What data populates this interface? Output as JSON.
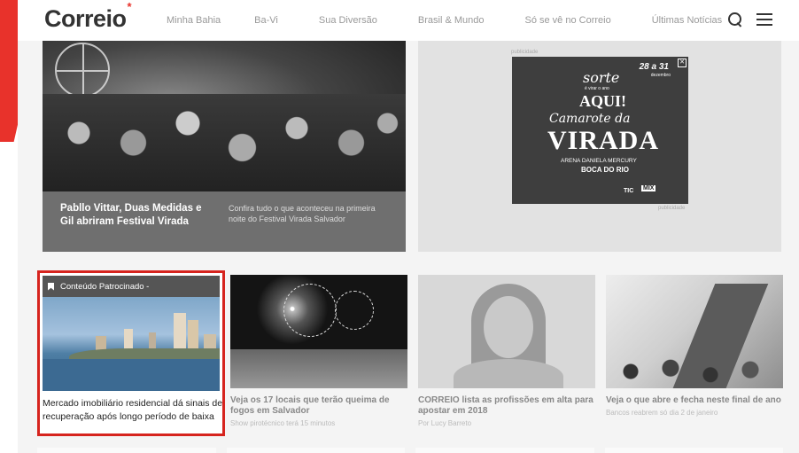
{
  "header": {
    "logo": "Correio",
    "logo_mark": "*",
    "nav": [
      "Minha Bahia",
      "Ba-Vi",
      "Sua Diversão",
      "Brasil & Mundo",
      "Só se vê no Correio",
      "Últimas Notícias"
    ]
  },
  "hero": {
    "title": "Pabllo Vittar, Duas Medidas e Gil abriram Festival Virada",
    "description": "Confira tudo o que aconteceu na primeira noite do Festival Virada Salvador"
  },
  "ad": {
    "label_top": "publicidade",
    "label_bottom": "publicidade",
    "date": "28 a 31",
    "date_sub": "dezembro",
    "sorte": "sorte",
    "sorte_sub": "é virar o ano",
    "aqui": "AQUI!",
    "camarote": "Camarote da",
    "virada": "VIRADA",
    "arena": "ARENA DANIELA MERCURY",
    "boca": "BOCA DO RIO",
    "brand1": "TIC",
    "brand2": "MIX"
  },
  "cards": [
    {
      "sponsor_label": "Conteúdo Patrocinado -",
      "title": "Mercado imobiliário residencial dá sinais de recuperação após longo período de baixa"
    },
    {
      "title": "Veja os 17 locais que terão queima de fogos em Salvador",
      "subtitle": "Show pirotécnico terá 15 minutos"
    },
    {
      "title": "CORREIO lista as profissões em alta para apostar em 2018",
      "subtitle": "Por Lucy Barreto"
    },
    {
      "title": "Veja o que abre e fecha neste final de ano",
      "subtitle": "Bancos reabrem só dia 2 de janeiro"
    }
  ],
  "colors": {
    "accent": "#e8322b",
    "highlight_border": "#d6241e"
  }
}
